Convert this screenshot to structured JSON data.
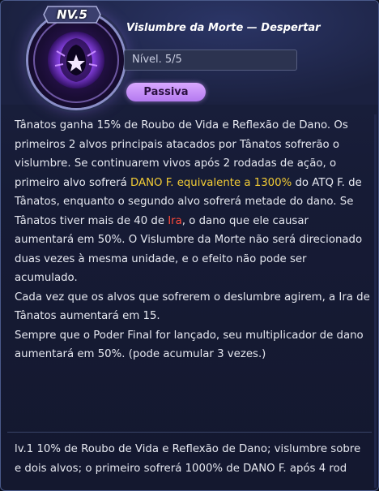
{
  "skill": {
    "level_badge": "NV.5",
    "title": "Vislumbre da Morte — Despertar",
    "level_label": "Nível. 5/5",
    "type_tag": "Passiva",
    "icon": "hooded-figure-star-icon"
  },
  "description": {
    "p1_a": "Tânatos ganha 15% de Roubo de Vida e Reflexão de Dano. Os primeiros 2 alvos principais atacados por Tânatos sofrerão o vislumbre. Se continuarem vivos após 2 rodadas de ação, o primeiro alvo sofrerá ",
    "p1_hl": "DANO F. equivalente a 1300%",
    "p1_b": " do ATQ F. de Tânatos, enquanto o segundo alvo sofrerá metade do dano. Se Tânatos tiver mais de 40 de ",
    "p1_red": "Ira",
    "p1_c": ", o dano que ele causar aumentará em 50%. O Vislumbre da Morte não será direcionado duas vezes à mesma unidade, e o efeito não pode ser acumulado.",
    "p2": "Cada vez que os alvos que sofrerem o deslumbre agirem, a Ira de Tânatos aumentará em 15.",
    "p3": "Sempre que o Poder Final for lançado, seu multiplicador de dano aumentará em 50%. (pode acumular 3 vezes.)"
  },
  "level_notes": {
    "line1": "lv.1 10% de Roubo de Vida e Reflexão de Dano; vislumbre sobre",
    "line2": "e dois alvos; o primeiro sofrerá 1000% de DANO F. após 4 rod"
  },
  "colors": {
    "highlight_gold": "#f3cc35",
    "highlight_red": "#ff4a3a",
    "tag_purple": "#c992f7"
  }
}
